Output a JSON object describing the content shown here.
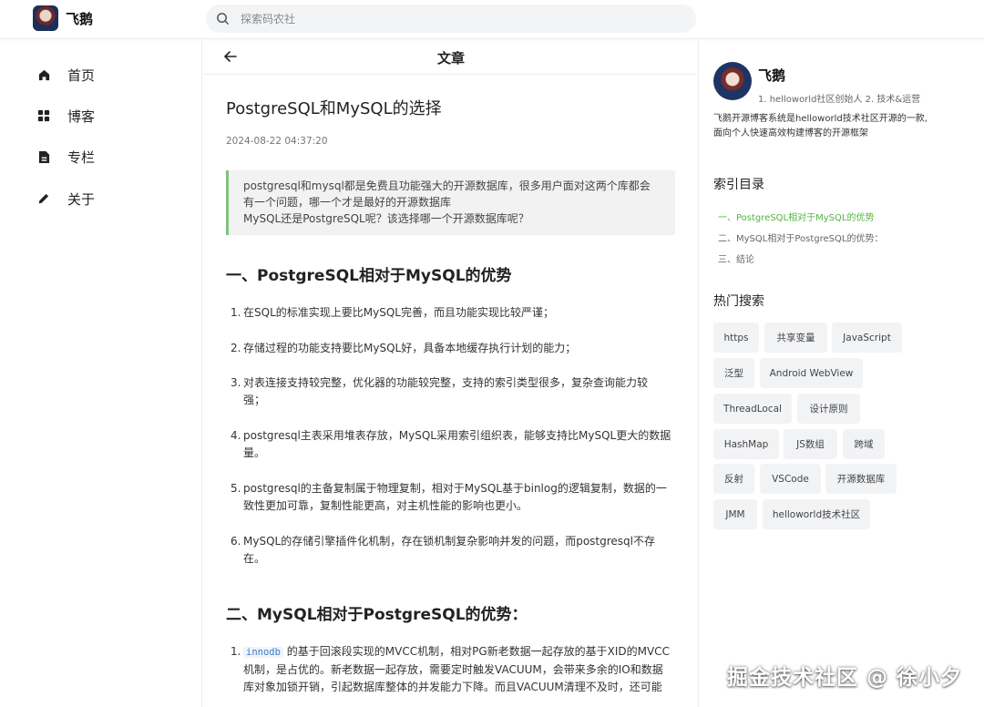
{
  "header": {
    "brand": "飞鹅",
    "search_placeholder": "探索码农社"
  },
  "nav": [
    {
      "label": "首页",
      "icon": "home-icon"
    },
    {
      "label": "博客",
      "icon": "grid-icon"
    },
    {
      "label": "专栏",
      "icon": "document-icon"
    },
    {
      "label": "关于",
      "icon": "pencil-icon"
    }
  ],
  "main": {
    "header_title": "文章",
    "article_title": "PostgreSQL和MySQL的选择",
    "date": "2024-08-22 04:37:20",
    "quote_line1": "postgresql和mysql都是免费且功能强大的开源数据库，很多用户面对这两个库都会",
    "quote_line2": "有一个问题，哪一个才是最好的开源数据库",
    "quote_line3": "MySQL还是PostgreSQL呢？该选择哪一个开源数据库呢？",
    "section1_title": "一、PostgreSQL相对于MySQL的优势",
    "section1_items": [
      {
        "num": "1.",
        "l1": "在SQL的标准实现上要比MySQL完善，而且功能实现比较严谨；",
        "l2": ""
      },
      {
        "num": "2.",
        "l1": "存储过程的功能支持要比MySQL好，具备本地缓存执行计划的能力；",
        "l2": ""
      },
      {
        "num": "3.",
        "l1": "对表连接支持较完整，优化器的功能较完整，支持的索引类型很多，复杂查询能力较",
        "l2": "强；"
      },
      {
        "num": "4.",
        "l1": "postgresql主表采用堆表存放，MySQL采用索引组织表，能够支持比MySQL更大的数据",
        "l2": "量。"
      },
      {
        "num": "5.",
        "l1": "postgresql的主备复制属于物理复制，相对于MySQL基于binlog的逻辑复制，数据的一",
        "l2": "致性更加可靠，复制性能更高，对主机性能的影响也更小。"
      },
      {
        "num": "6.",
        "l1": "MySQL的存储引擎插件化机制，存在锁机制复杂影响并发的问题，而postgresql不存",
        "l2": "在。"
      }
    ],
    "section2_title": "二、MySQL相对于PostgreSQL的优势：",
    "section2_item1": {
      "num": "1.",
      "code": "innodb",
      "l1_rest": "的基于回滚段实现的MVCC机制，相对PG新老数据一起存放的基于XID的MVCC",
      "l2": "机制，是占优的。新老数据一起存放，需要定时触发VACUUM，会带来多余的IO和数据",
      "l3": "库对象加锁开销，引起数据库整体的并发能力下降。而且VACUUM清理不及时，还可能"
    }
  },
  "sidebar": {
    "author_name": "飞鹅",
    "author_sub": "1. helloworld社区创始人 2. 技术&运营",
    "intro_l1": "飞鹅开源博客系统是helloworld技术社区开源的一款,",
    "intro_l2": "面向个人快速高效构建博客的开源框架",
    "toc_title": "索引目录",
    "toc": [
      "一、PostgreSQL相对于MySQL的优势",
      "二、MySQL相对于PostgreSQL的优势：",
      "三、结论"
    ],
    "hot_title": "热门搜索",
    "tags": [
      "https",
      "共享变量",
      "JavaScript",
      "泛型",
      "Android WebView",
      "ThreadLocal",
      "设计原则",
      "HashMap",
      "JS数组",
      "跨域",
      "反射",
      "VSCode",
      "开源数据库",
      "JMM",
      "helloworld技术社区"
    ]
  },
  "watermark": "掘金技术社区 @ 徐小夕",
  "colors": {
    "accent": "#52b43f",
    "quote_border": "#7ec27e",
    "code": "#3d7fc7"
  }
}
